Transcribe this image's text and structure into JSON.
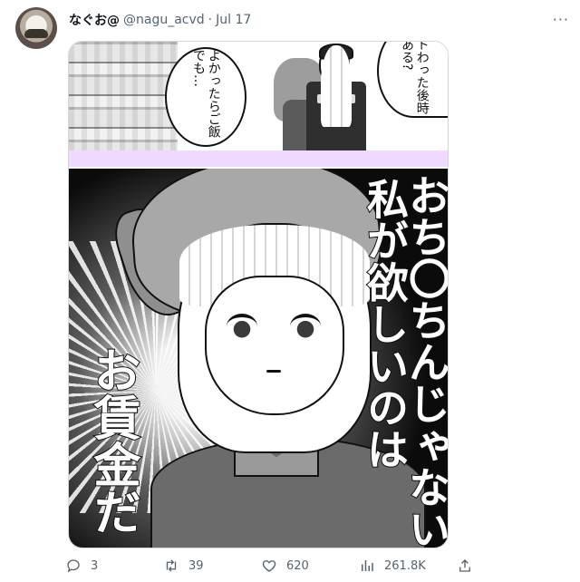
{
  "tweet": {
    "author_name": "なぐお@",
    "author_handle": "@nagu_acvd",
    "separator": "·",
    "date": "Jul 17",
    "more": "···"
  },
  "image": {
    "panel1": {
      "bubble_left": "よかったらご飯でも…",
      "bubble_right": "イトわった後時間ある?"
    },
    "panel2": {
      "caption_col1": "私が欲しいのは",
      "caption_col2": "おち〇ちんじゃない",
      "caption_left": "お賃金だ"
    },
    "colors": {
      "divider": "#eedbff",
      "border": "#cfd9de"
    }
  },
  "actions": [
    {
      "icon": "reply-icon",
      "count": "3"
    },
    {
      "icon": "retweet-icon",
      "count": "39"
    },
    {
      "icon": "like-icon",
      "count": "620"
    },
    {
      "icon": "views-icon",
      "count": "261.8K"
    },
    {
      "icon": "share-icon",
      "count": ""
    }
  ]
}
